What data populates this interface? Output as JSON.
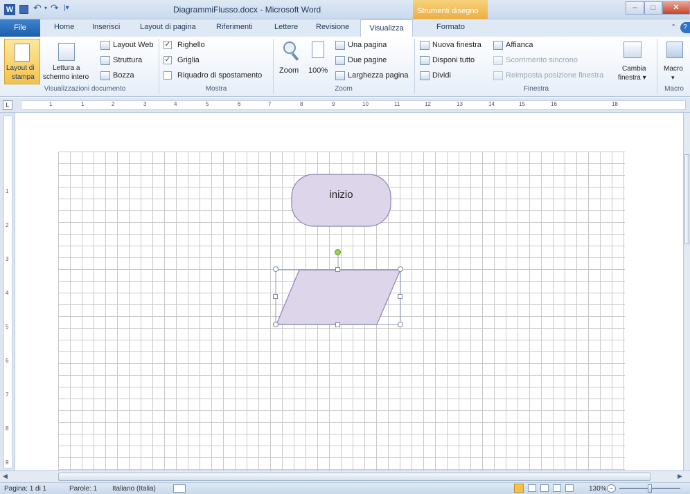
{
  "window": {
    "title": "DiagrammiFlusso.docx - Microsoft Word",
    "context_header": "Strumenti disegno",
    "min_label": "–",
    "max_label": "□",
    "close_label": "✕"
  },
  "tabs": {
    "file": "File",
    "home": "Home",
    "inserisci": "Inserisci",
    "layout_pagina": "Layout di pagina",
    "riferimenti": "Riferimenti",
    "lettere": "Lettere",
    "revisione": "Revisione",
    "visualizza": "Visualizza",
    "formato": "Formato"
  },
  "ribbon": {
    "views": {
      "layout_line1": "Layout di",
      "layout_line2": "stampa",
      "lettura_line1": "Lettura a",
      "lettura_line2": "schermo intero",
      "layout_web": "Layout Web",
      "struttura": "Struttura",
      "bozza": "Bozza",
      "group": "Visualizzazioni documento"
    },
    "mostra": {
      "righello": "Righello",
      "griglia": "Griglia",
      "riquadro": "Riquadro di spostamento",
      "group": "Mostra",
      "righello_checked": true,
      "griglia_checked": true,
      "riquadro_checked": false
    },
    "zoom": {
      "zoom": "Zoom",
      "cento": "100%",
      "una_pagina": "Una pagina",
      "due_pagine": "Due pagine",
      "larghezza": "Larghezza pagina",
      "group": "Zoom"
    },
    "finestra": {
      "nuova": "Nuova finestra",
      "disponi": "Disponi tutto",
      "dividi": "Dividi",
      "affianca": "Affianca",
      "scorrimento": "Scorrimento sincrono",
      "reimposta": "Reimposta posizione finestra",
      "cambia_line1": "Cambia",
      "cambia_line2": "finestra ▾",
      "group": "Finestra"
    },
    "macro": {
      "macro": "Macro",
      "arrow": "▾",
      "group": "Macro"
    }
  },
  "ruler": {
    "numbers": [
      "1",
      "1",
      "2",
      "3",
      "4",
      "5",
      "6",
      "7",
      "8",
      "9",
      "10",
      "11",
      "12",
      "13",
      "14",
      "15",
      "16",
      "18"
    ],
    "vnumbers": [
      "1",
      "2",
      "3",
      "4",
      "5",
      "6",
      "7",
      "8",
      "9"
    ]
  },
  "diagram": {
    "start_label": "inizio"
  },
  "status": {
    "pagina": "Pagina: 1 di 1",
    "parole": "Parole: 1",
    "lingua": "Italiano (Italia)",
    "zoom": "130%"
  }
}
